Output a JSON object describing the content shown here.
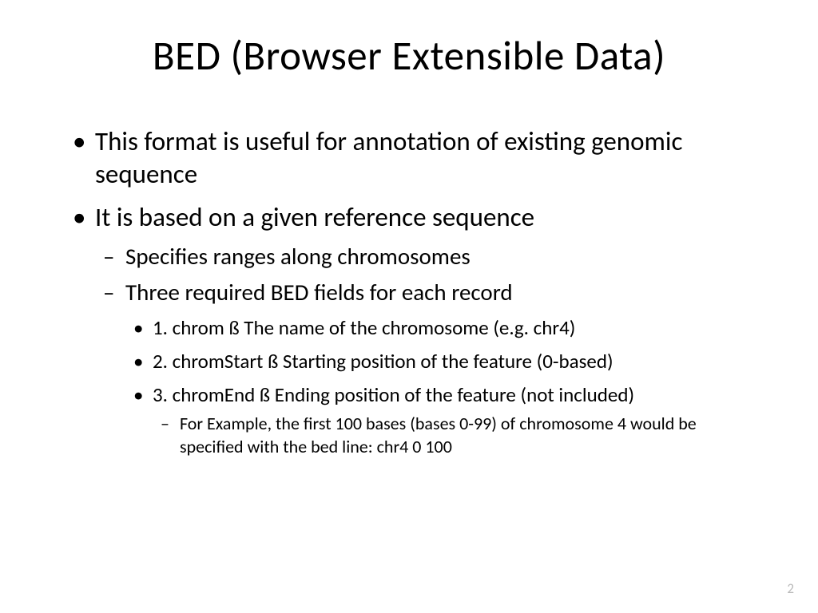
{
  "title": "BED (Browser Extensible Data)",
  "bullets": {
    "b1": "This format is useful for annotation of existing genomic sequence",
    "b2": "It is based on a given reference sequence",
    "b2_1": "Specifies ranges along chromosomes",
    "b2_2": "Three required BED fields for each record",
    "b2_2_1": "1. chrom ß The name of the chromosome (e.g. chr4)",
    "b2_2_2": "2. chromStart ß Starting position of the feature (0-based)",
    "b2_2_3": "3. chromEnd ß Ending position of the feature (not included)",
    "b2_2_3_1": "For Example, the first 100 bases (bases 0-99) of chromosome 4 would be specified with the bed line:  chr4   0    100"
  },
  "page_number": "2"
}
